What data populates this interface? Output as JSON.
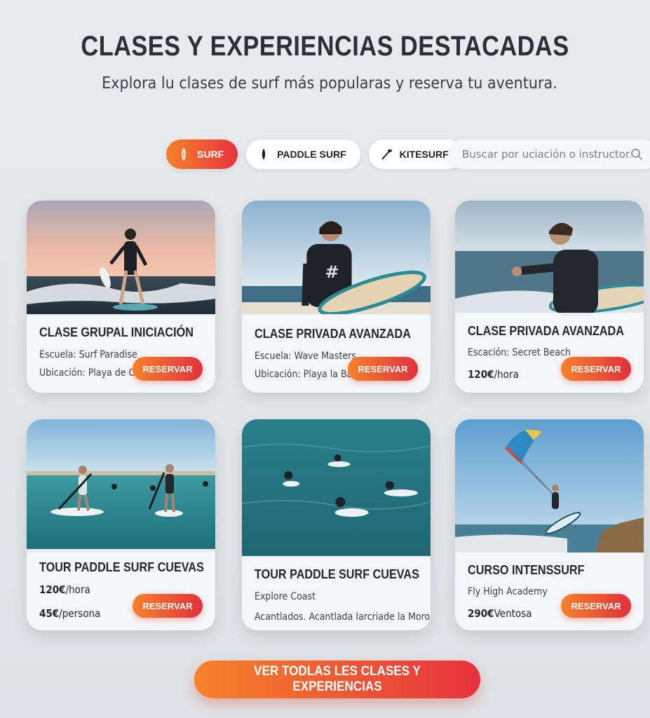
{
  "header": {
    "title": "CLASES Y EXPERIENCIAS DESTACADAS",
    "subtitle": "Explora lu clases de surf más popularas y reserva tu aventura."
  },
  "filters": {
    "chips": [
      {
        "label": "SURF",
        "icon": "surfboard-icon",
        "active": true
      },
      {
        "label": "PADDLE SURF",
        "icon": "paddle-board-icon",
        "active": false
      },
      {
        "label": "KITESURF",
        "icon": "kite-icon",
        "active": false
      }
    ],
    "search_placeholder": "Buscar por uciación o instructor...",
    "search_icon": "search-icon"
  },
  "cards": [
    {
      "title": "CLASE GRUPAL INICIACIÓN",
      "line1": "Escuela: Surf Paradise",
      "line2": "Ubicación: Playa de Csm",
      "button": "RESERVAR"
    },
    {
      "title": "CLASE PRIVADA AVANZADA",
      "line1": "Escuela: Wave Masters",
      "line2": "Ubicación: Playa la Bar",
      "button": "RESERVAR"
    },
    {
      "title": "CLASE PRIVADA AVANZADA",
      "line1": "Escación: Secret Beach",
      "price": "120€",
      "price_unit": "/hora",
      "button": "RESERVAR"
    },
    {
      "title": "TOUR PADDLE SURF CUEVAS",
      "price": "120€",
      "price_unit": "/hora",
      "price2": "45€",
      "price2_unit": "/persona",
      "button": "RESERVAR"
    },
    {
      "title": "TOUR PADDLE SURF CUEVAS",
      "line1": "Explore Coast",
      "line2": "Acantlados. Acantlada Iarcriade la Moro"
    },
    {
      "title": "CURSO INTENSSURF",
      "line1": "Fly High Academy",
      "price": "290€",
      "price_unit": "Ventosa",
      "button": "RESERVAR"
    }
  ],
  "cta_label": "VER TODLAS LES CLASES Y EXPERIENCIAS",
  "colors": {
    "accent_start": "#f7822a",
    "accent_end": "#e5323d",
    "background": "#e5e7ea"
  }
}
